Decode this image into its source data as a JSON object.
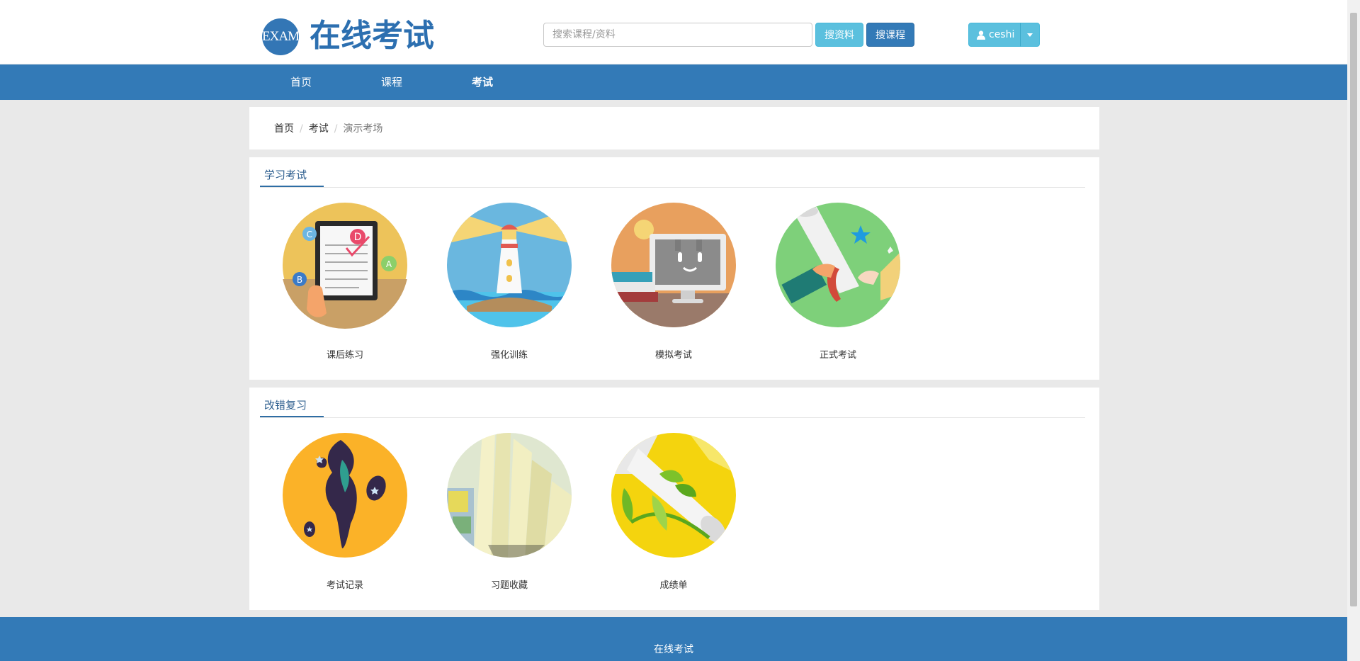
{
  "header": {
    "logo_text": "EXAM",
    "title": "在线考试",
    "search": {
      "placeholder": "搜索课程/资料",
      "value": ""
    },
    "search_material_label": "搜资料",
    "search_course_label": "搜课程",
    "user_name": "ceshi"
  },
  "nav": {
    "items": [
      {
        "label": "首页",
        "active": false
      },
      {
        "label": "课程",
        "active": false
      },
      {
        "label": "考试",
        "active": true
      }
    ]
  },
  "breadcrumb": {
    "items": [
      "首页",
      "考试"
    ],
    "current": "演示考场"
  },
  "sections": [
    {
      "title": "学习考试",
      "cards": [
        {
          "label": "课后练习",
          "icon": "exam-tablet-icon"
        },
        {
          "label": "强化训练",
          "icon": "lighthouse-icon"
        },
        {
          "label": "模拟考试",
          "icon": "computer-smile-icon"
        },
        {
          "label": "正式考试",
          "icon": "diploma-icon"
        }
      ]
    },
    {
      "title": "改错复习",
      "cards": [
        {
          "label": "考试记录",
          "icon": "ink-splash-icon"
        },
        {
          "label": "习题收藏",
          "icon": "book-pages-icon"
        },
        {
          "label": "成绩单",
          "icon": "scroll-ribbon-icon"
        }
      ]
    }
  ],
  "footer": {
    "text": "在线考试"
  },
  "colors": {
    "primary": "#337ab7",
    "info": "#5bc0de",
    "page_bg": "#e9e9e9"
  }
}
